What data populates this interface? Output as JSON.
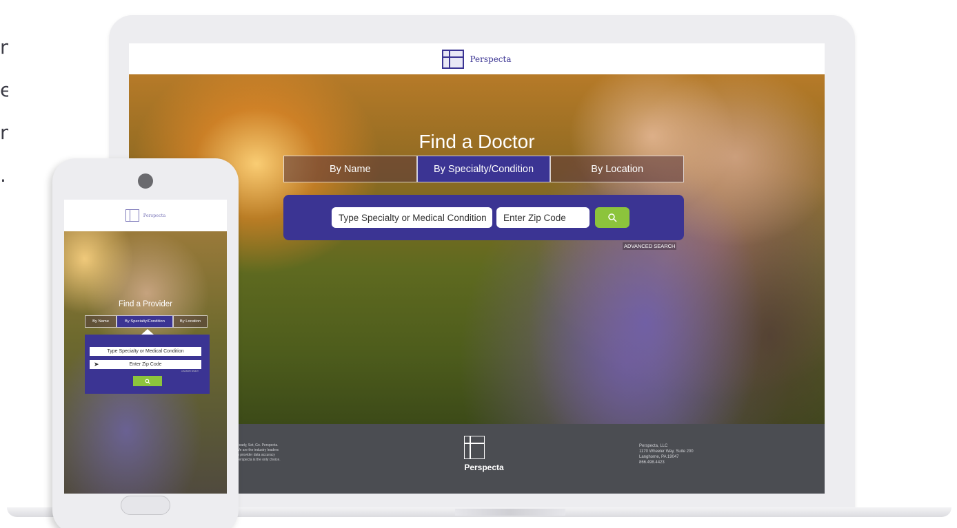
{
  "side_text": {
    "lines": [
      "n",
      "e.",
      "n",
      "."
    ]
  },
  "desktop": {
    "brand": "Perspecta",
    "hero_title": "Find a Doctor",
    "tabs": [
      {
        "label": "By Name"
      },
      {
        "label": "By Specialty/Condition",
        "active": true
      },
      {
        "label": "By Location"
      }
    ],
    "search": {
      "specialty_placeholder": "Type Specialty or Medical Condition",
      "zip_placeholder": "Enter Zip Code",
      "button_icon": "search-icon"
    },
    "advanced_search": "ADVANCED SEARCH",
    "footer": {
      "tagline_lines": [
        "Ready, Set, Go. Perspecta.",
        "We are the industry leaders",
        "in provider data accuracy",
        "Perspecta is the only choice."
      ],
      "brand": "Perspecta",
      "address_lines": [
        "Perspecta, LLC",
        "1170 Wheeler Way, Suite 200",
        "Langhorne, PA 19047",
        "866.498.4423"
      ]
    }
  },
  "mobile": {
    "brand": "Perspecta",
    "hero_title": "Find a Provider",
    "tabs": [
      {
        "label": "By Name"
      },
      {
        "label": "By Specialty/Condition",
        "active": true
      },
      {
        "label": "By Location"
      }
    ],
    "specialty_placeholder": "Type Specialty or Medical Condition",
    "zip_placeholder": "Enter Zip Code",
    "advanced_search": "ADVANCED SEARCH",
    "button_icon": "search-icon"
  },
  "colors": {
    "brand_purple": "#3b3493",
    "accent_green": "#8cc43c",
    "footer_gray": "#4b4d52",
    "device_frame": "#ededf0"
  }
}
